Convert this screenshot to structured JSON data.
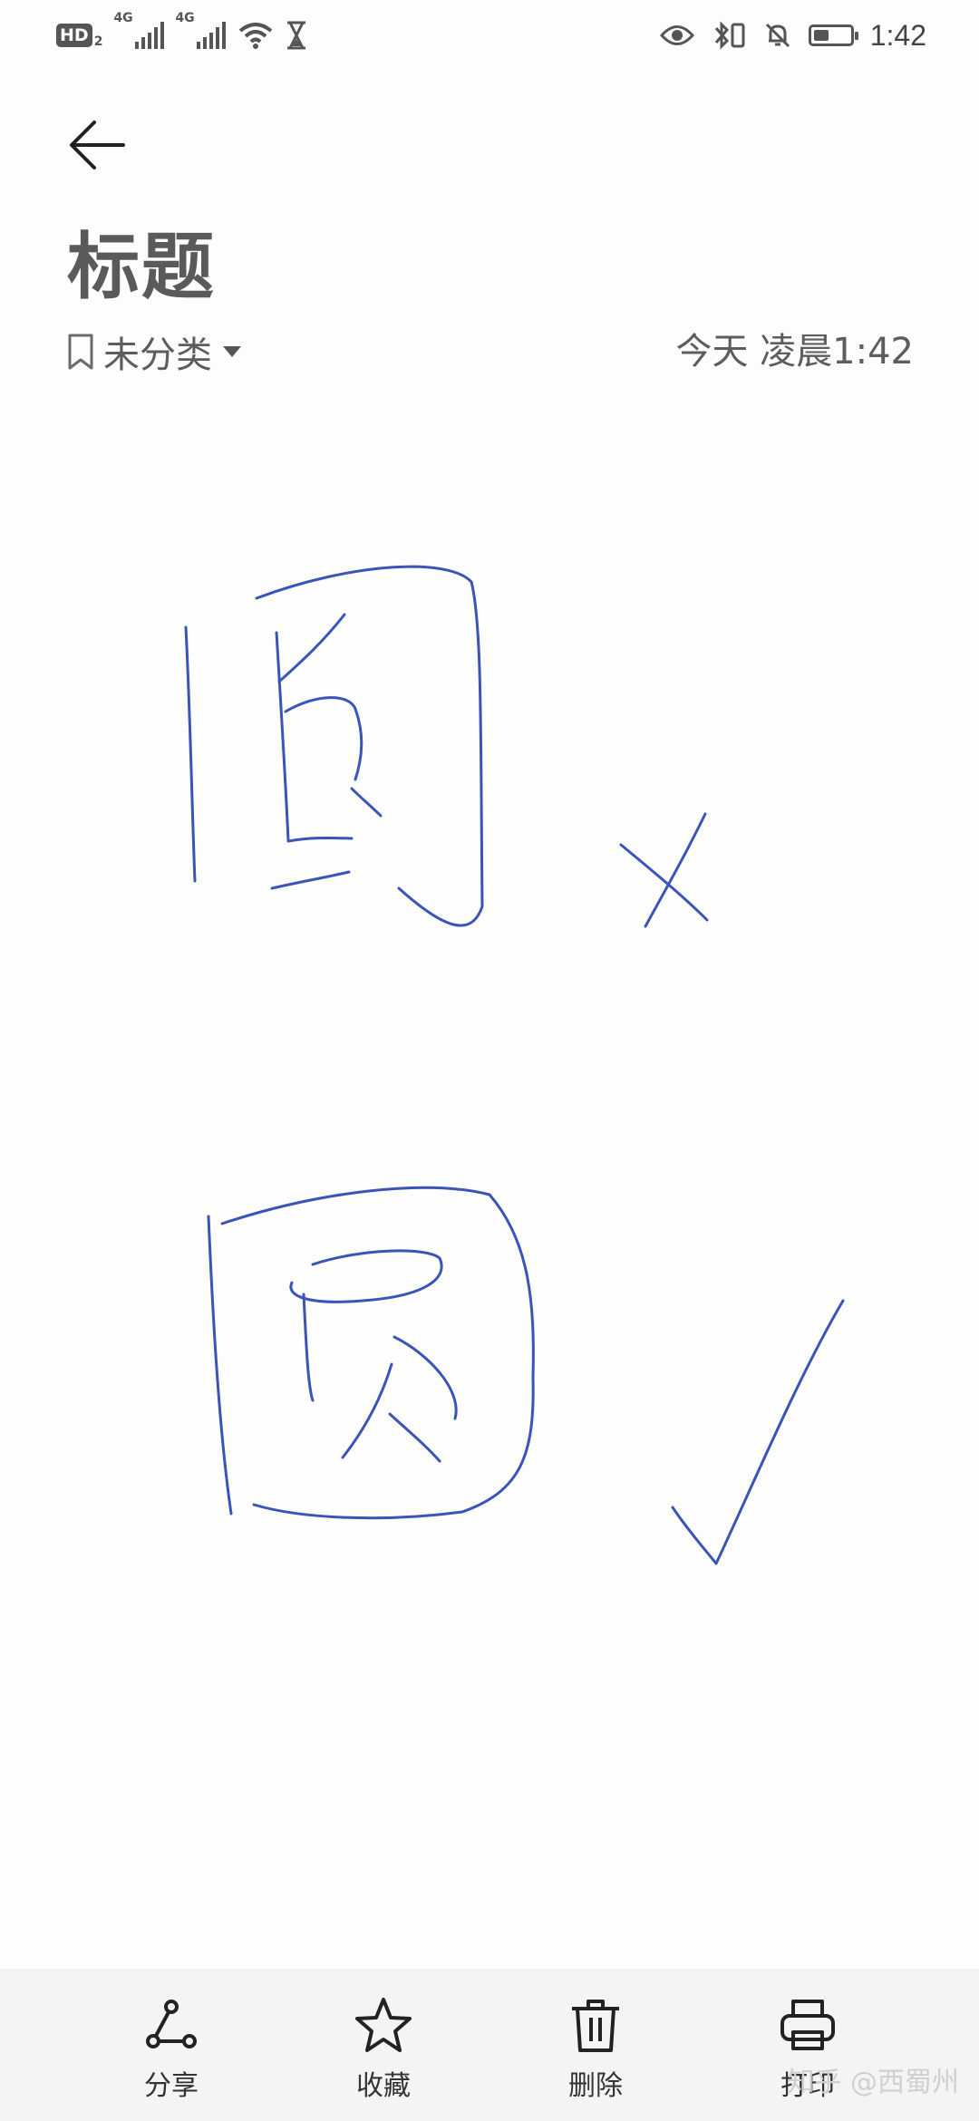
{
  "status_bar": {
    "hd_label": "HD",
    "sim_number": "2",
    "network_1": "4G",
    "network_2": "4G",
    "time": "1:42"
  },
  "note": {
    "title": "标题",
    "category": "未分类",
    "datetime": "今天 凌晨1:42"
  },
  "toolbar": {
    "share_label": "分享",
    "favorite_label": "收藏",
    "delete_label": "删除",
    "print_label": "打印"
  },
  "watermark": "知乎 @西蜀州",
  "colors": {
    "ink": "#3a54b8",
    "toolbar_bg": "#f4f4f2",
    "page_bg": "#fdfdfb"
  }
}
